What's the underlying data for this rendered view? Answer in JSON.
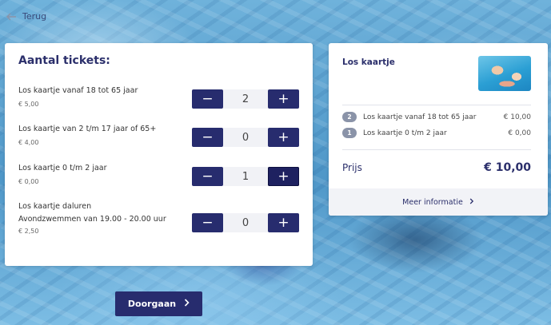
{
  "back": {
    "label": "Terug"
  },
  "tickets": {
    "heading": "Aantal tickets:",
    "items": [
      {
        "name": "Los kaartje vanaf 18 tot 65 jaar",
        "subtitle": "",
        "price": "€ 5,00",
        "qty": "2"
      },
      {
        "name": "Los kaartje van 2 t/m 17 jaar of 65+",
        "subtitle": "",
        "price": "€ 4,00",
        "qty": "0"
      },
      {
        "name": "Los kaartje 0 t/m 2 jaar",
        "subtitle": "",
        "price": "€ 0,00",
        "qty": "1"
      },
      {
        "name": "Los kaartje daluren",
        "subtitle": "Avondzwemmen van 19.00 - 20.00 uur",
        "price": "€ 2,50",
        "qty": "0"
      }
    ],
    "minus": "−",
    "plus": "+"
  },
  "continue": {
    "label": "Doorgaan"
  },
  "summary": {
    "title": "Los kaartje",
    "lines": [
      {
        "count": "2",
        "name": "Los kaartje vanaf 18 tot 65 jaar",
        "amount": "€ 10,00"
      },
      {
        "count": "1",
        "name": "Los kaartje 0 t/m 2 jaar",
        "amount": "€ 0,00"
      }
    ],
    "total_label": "Prijs",
    "total_value": "€ 10,00",
    "more_label": "Meer informatie"
  }
}
